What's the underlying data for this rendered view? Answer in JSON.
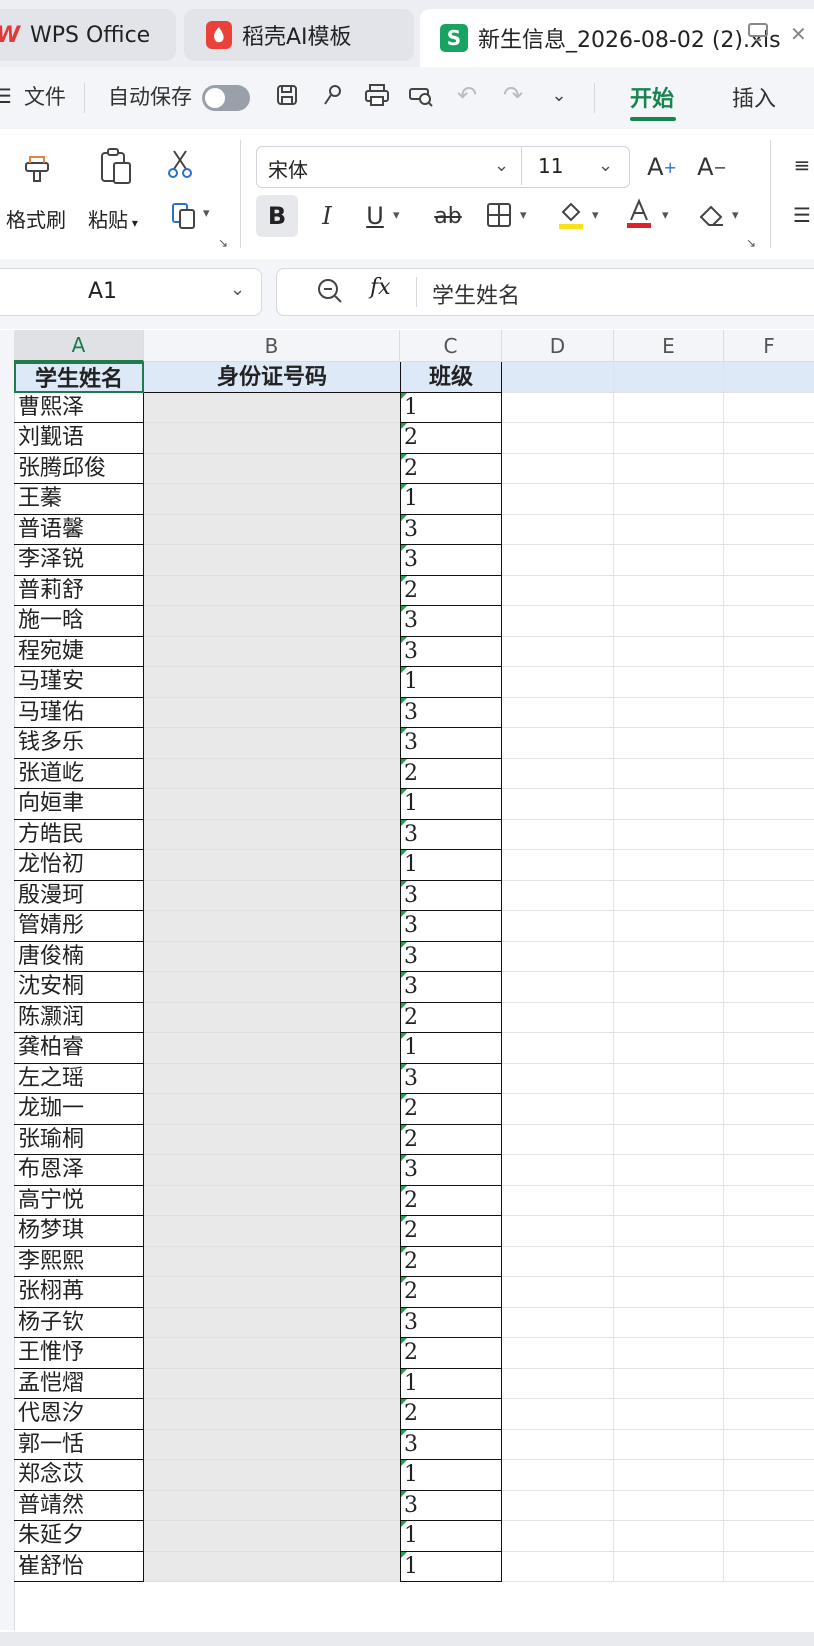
{
  "tabs": [
    {
      "label": "WPS Office"
    },
    {
      "label": "稻壳AI模板"
    },
    {
      "label": "新生信息_2026-08-02 (2).xls"
    }
  ],
  "quickbar": {
    "file_label": "文件",
    "autosave_label": "自动保存",
    "tab_start": "开始",
    "tab_insert": "插入"
  },
  "ribbon": {
    "format_painter": "格式刷",
    "paste": "粘贴",
    "font_name": "宋体",
    "font_size": "11",
    "bold": "B",
    "italic": "I",
    "underline": "U",
    "strike": "ab",
    "increase_font": "A",
    "decrease_font": "A"
  },
  "formula_bar": {
    "cell_ref": "A1",
    "fx": "fx",
    "content": "学生姓名"
  },
  "sheet": {
    "columns": [
      "A",
      "B",
      "C",
      "D",
      "E",
      "F"
    ],
    "headers": [
      "学生姓名",
      "身份证号码",
      "班级"
    ],
    "rows": [
      {
        "name": "曹熙泽",
        "class": "1"
      },
      {
        "name": "刘觐语",
        "class": "2"
      },
      {
        "name": "张腾邱俊",
        "class": "2"
      },
      {
        "name": "王蓁",
        "class": "1"
      },
      {
        "name": "普语馨",
        "class": "3"
      },
      {
        "name": "李泽锐",
        "class": "3"
      },
      {
        "name": "普莉舒",
        "class": "2"
      },
      {
        "name": "施一晗",
        "class": "3"
      },
      {
        "name": "程宛婕",
        "class": "3"
      },
      {
        "name": "马瑾安",
        "class": "1"
      },
      {
        "name": "马瑾佑",
        "class": "3"
      },
      {
        "name": "钱多乐",
        "class": "3"
      },
      {
        "name": "张道屹",
        "class": "2"
      },
      {
        "name": "向姮聿",
        "class": "1"
      },
      {
        "name": "方皓民",
        "class": "3"
      },
      {
        "name": "龙怡初",
        "class": "1"
      },
      {
        "name": "殷漫珂",
        "class": "3"
      },
      {
        "name": "管婧彤",
        "class": "3"
      },
      {
        "name": "唐俊楠",
        "class": "3"
      },
      {
        "name": "沈安桐",
        "class": "3"
      },
      {
        "name": "陈灏润",
        "class": "2"
      },
      {
        "name": "龚柏睿",
        "class": "1"
      },
      {
        "name": "左之瑶",
        "class": "3"
      },
      {
        "name": "龙珈一",
        "class": "2"
      },
      {
        "name": "张瑜桐",
        "class": "2"
      },
      {
        "name": "布恩泽",
        "class": "3"
      },
      {
        "name": "高宁悦",
        "class": "2"
      },
      {
        "name": "杨梦琪",
        "class": "2"
      },
      {
        "name": "李熙熙",
        "class": "2"
      },
      {
        "name": "张栩苒",
        "class": "2"
      },
      {
        "name": "杨子钦",
        "class": "3"
      },
      {
        "name": "王惟忬",
        "class": "2"
      },
      {
        "name": "孟恺熠",
        "class": "1"
      },
      {
        "name": "代恩汐",
        "class": "2"
      },
      {
        "name": "郭一恬",
        "class": "3"
      },
      {
        "name": "郑念苡",
        "class": "1"
      },
      {
        "name": "普靖然",
        "class": "3"
      },
      {
        "name": "朱延夕",
        "class": "1"
      },
      {
        "name": "崔舒怡",
        "class": "1"
      }
    ]
  }
}
